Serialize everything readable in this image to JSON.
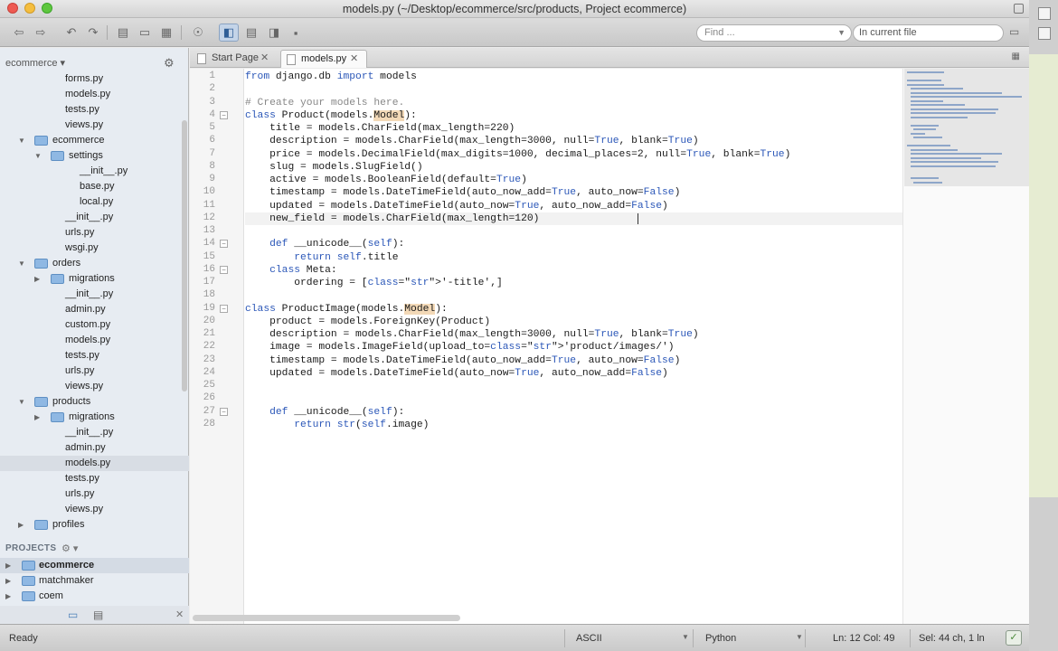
{
  "window": {
    "title": "models.py (~/Desktop/ecommerce/src/products, Project ecommerce)"
  },
  "toolbar": {
    "find_placeholder": "Find ...",
    "scope": "In current file"
  },
  "sidebar": {
    "project_label": "ecommerce",
    "tree": [
      {
        "label": "forms.py",
        "indent": 1,
        "type": "file"
      },
      {
        "label": "models.py",
        "indent": 1,
        "type": "file"
      },
      {
        "label": "tests.py",
        "indent": 1,
        "type": "file"
      },
      {
        "label": "views.py",
        "indent": 1,
        "type": "file"
      },
      {
        "label": "ecommerce",
        "indent": 0,
        "type": "folder",
        "open": true
      },
      {
        "label": "settings",
        "indent": 1,
        "type": "folder",
        "open": true
      },
      {
        "label": "__init__.py",
        "indent": 2,
        "type": "file"
      },
      {
        "label": "base.py",
        "indent": 2,
        "type": "file"
      },
      {
        "label": "local.py",
        "indent": 2,
        "type": "file"
      },
      {
        "label": "__init__.py",
        "indent": 1,
        "type": "file"
      },
      {
        "label": "urls.py",
        "indent": 1,
        "type": "file"
      },
      {
        "label": "wsgi.py",
        "indent": 1,
        "type": "file"
      },
      {
        "label": "orders",
        "indent": 0,
        "type": "folder",
        "open": true
      },
      {
        "label": "migrations",
        "indent": 1,
        "type": "folder",
        "open": false
      },
      {
        "label": "__init__.py",
        "indent": 1,
        "type": "file"
      },
      {
        "label": "admin.py",
        "indent": 1,
        "type": "file"
      },
      {
        "label": "custom.py",
        "indent": 1,
        "type": "file"
      },
      {
        "label": "models.py",
        "indent": 1,
        "type": "file"
      },
      {
        "label": "tests.py",
        "indent": 1,
        "type": "file"
      },
      {
        "label": "urls.py",
        "indent": 1,
        "type": "file"
      },
      {
        "label": "views.py",
        "indent": 1,
        "type": "file"
      },
      {
        "label": "products",
        "indent": 0,
        "type": "folder",
        "open": true
      },
      {
        "label": "migrations",
        "indent": 1,
        "type": "folder",
        "open": false
      },
      {
        "label": "__init__.py",
        "indent": 1,
        "type": "file"
      },
      {
        "label": "admin.py",
        "indent": 1,
        "type": "file"
      },
      {
        "label": "models.py",
        "indent": 1,
        "type": "file",
        "selected": true
      },
      {
        "label": "tests.py",
        "indent": 1,
        "type": "file"
      },
      {
        "label": "urls.py",
        "indent": 1,
        "type": "file"
      },
      {
        "label": "views.py",
        "indent": 1,
        "type": "file"
      },
      {
        "label": "profiles",
        "indent": 0,
        "type": "folder",
        "open": false
      }
    ],
    "projects_label": "PROJECTS",
    "projects": [
      {
        "label": "ecommerce",
        "active": true
      },
      {
        "label": "matchmaker",
        "active": false
      },
      {
        "label": "coem",
        "active": false
      }
    ]
  },
  "tabs": [
    {
      "label": "Start Page",
      "active": false
    },
    {
      "label": "models.py",
      "active": true
    }
  ],
  "editor": {
    "current_line": 12,
    "folds": [
      4,
      14,
      16,
      19,
      27
    ],
    "lines": [
      "from django.db import models",
      "",
      "# Create your models here.",
      "class Product(models.Model):",
      "    title = models.CharField(max_length=220)",
      "    description = models.CharField(max_length=3000, null=True, blank=True)",
      "    price = models.DecimalField(max_digits=1000, decimal_places=2, null=True, blank=True)",
      "    slug = models.SlugField()",
      "    active = models.BooleanField(default=True)",
      "    timestamp = models.DateTimeField(auto_now_add=True, auto_now=False)",
      "    updated = models.DateTimeField(auto_now=True, auto_now_add=False)",
      "    new_field = models.CharField(max_length=120)",
      "",
      "    def __unicode__(self):",
      "        return self.title",
      "    class Meta:",
      "        ordering = ['-title',]",
      "",
      "class ProductImage(models.Model):",
      "    product = models.ForeignKey(Product)",
      "    description = models.CharField(max_length=3000, null=True, blank=True)",
      "    image = models.ImageField(upload_to='product/images/')",
      "    timestamp = models.DateTimeField(auto_now_add=True, auto_now=False)",
      "    updated = models.DateTimeField(auto_now=True, auto_now_add=False)",
      "",
      "",
      "    def __unicode__(self):",
      "        return str(self.image)"
    ]
  },
  "statusbar": {
    "state": "Ready",
    "encoding": "ASCII",
    "language": "Python",
    "position": "Ln: 12 Col: 49",
    "selection": "Sel: 44 ch, 1 ln"
  }
}
